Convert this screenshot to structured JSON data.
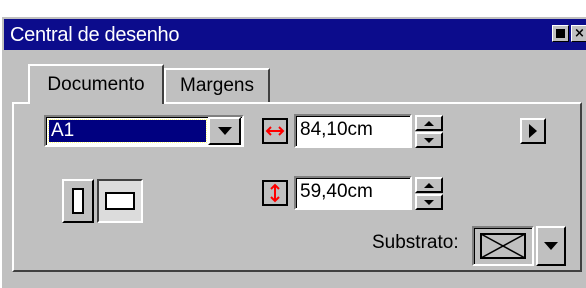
{
  "window": {
    "title": "Central de desenho",
    "minimize_label": "",
    "close_label": "×"
  },
  "tabs": [
    {
      "label": "Documento",
      "active": true
    },
    {
      "label": "Margens",
      "active": false
    }
  ],
  "page_size": {
    "selected": "A1"
  },
  "dimensions": {
    "width": "84,10cm",
    "height": "59,40cm"
  },
  "orientation": {
    "current": "landscape"
  },
  "substrate": {
    "label": "Substrato:"
  },
  "colors": {
    "titlebar": "#0c0c8c",
    "face": "#c0c0c0",
    "highlight_selection": "#000080",
    "dimension_arrow": "#ff0000"
  }
}
